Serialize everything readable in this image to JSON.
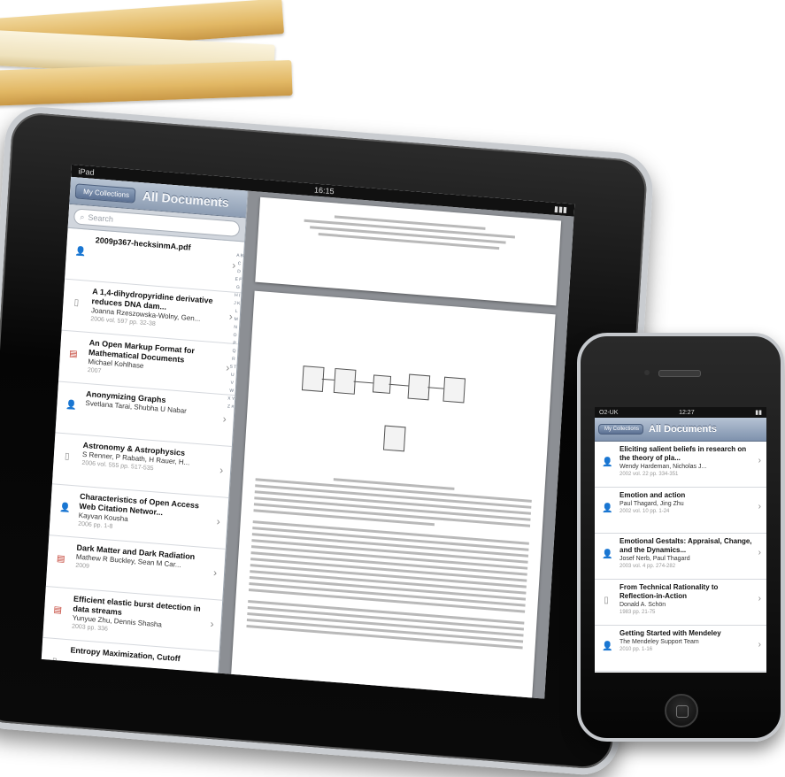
{
  "ipad": {
    "status": {
      "carrier": "iPad",
      "time": "16:15"
    },
    "nav": {
      "back_label": "My Collections",
      "title": "All Documents"
    },
    "search": {
      "placeholder": "Search"
    },
    "documents": [
      {
        "icon": "person-icon",
        "title": "2009p367-hecksinmA.pdf",
        "authors": "",
        "meta": ""
      },
      {
        "icon": "document-icon",
        "title": "A 1,4-dihydropyridine derivative reduces DNA dam...",
        "authors": "Joanna Rzeszowska-Wolny, Gen...",
        "meta": "2006 vol. 597 pp. 32-38"
      },
      {
        "icon": "pdf-icon",
        "title": "An Open Markup Format for Mathematical Documents",
        "authors": "Michael Kohlhase",
        "meta": "2007"
      },
      {
        "icon": "person-icon",
        "title": "Anonymizing Graphs",
        "authors": "Svetlana Tarai, Shubha U Nabar",
        "meta": ""
      },
      {
        "icon": "document-icon",
        "title": "Astronomy & Astrophysics",
        "authors": "S Renner, P Rabath, H Rauer, H...",
        "meta": "2006 vol. 555 pp. 517-535"
      },
      {
        "icon": "person-icon",
        "title": "Characteristics of Open Access Web Citation Networ...",
        "authors": "Kayvan Kousha",
        "meta": "2006 pp. 1-8"
      },
      {
        "icon": "pdf-icon",
        "title": "Dark Matter and Dark Radiation",
        "authors": "Mathew R Buckley, Sean M Car...",
        "meta": "2009"
      },
      {
        "icon": "pdf-icon",
        "title": "Efficient elastic burst detection in data streams",
        "authors": "Yunyue Zhu, Dennis Shasha",
        "meta": "2003 pp. 336"
      },
      {
        "icon": "document-icon",
        "title": "Entropy Maximization, Cutoff",
        "authors": "",
        "meta": ""
      }
    ],
    "alpha_index": "A B C D E F G H I J K L M N O P Q R S T U V W X Y Z #"
  },
  "iphone": {
    "status": {
      "carrier": "O2-UK",
      "time": "12:27"
    },
    "nav": {
      "back_label": "My Collections",
      "title": "All Documents"
    },
    "documents": [
      {
        "icon": "person-icon",
        "title": "Eliciting salient beliefs in research on the theory of pla...",
        "authors": "Wendy Hardeman, Nicholas J...",
        "meta": "2002 vol. 22 pp. 334-351"
      },
      {
        "icon": "person-icon",
        "title": "Emotion and action",
        "authors": "Paul Thagard, Jing Zhu",
        "meta": "2002 vol. 10 pp. 1-24"
      },
      {
        "icon": "person-icon",
        "title": "Emotional Gestalts: Appraisal, Change, and the Dynamics...",
        "authors": "Josef Nerb, Paul Thagard",
        "meta": "2003 vol. 4 pp. 274-282"
      },
      {
        "icon": "document-icon",
        "title": "From Technical Rationality to Reflection-in-Action",
        "authors": "Donald A. Schön",
        "meta": "1983 pp. 21-75"
      },
      {
        "icon": "person-icon",
        "title": "Getting Started with Mendeley",
        "authors": "The Mendeley Support Team",
        "meta": "2010 pp. 1-16"
      }
    ]
  },
  "colors": {
    "nav_blue": "#8d9db3",
    "folder_tan": "#e2b865",
    "bezel": "#050505"
  }
}
